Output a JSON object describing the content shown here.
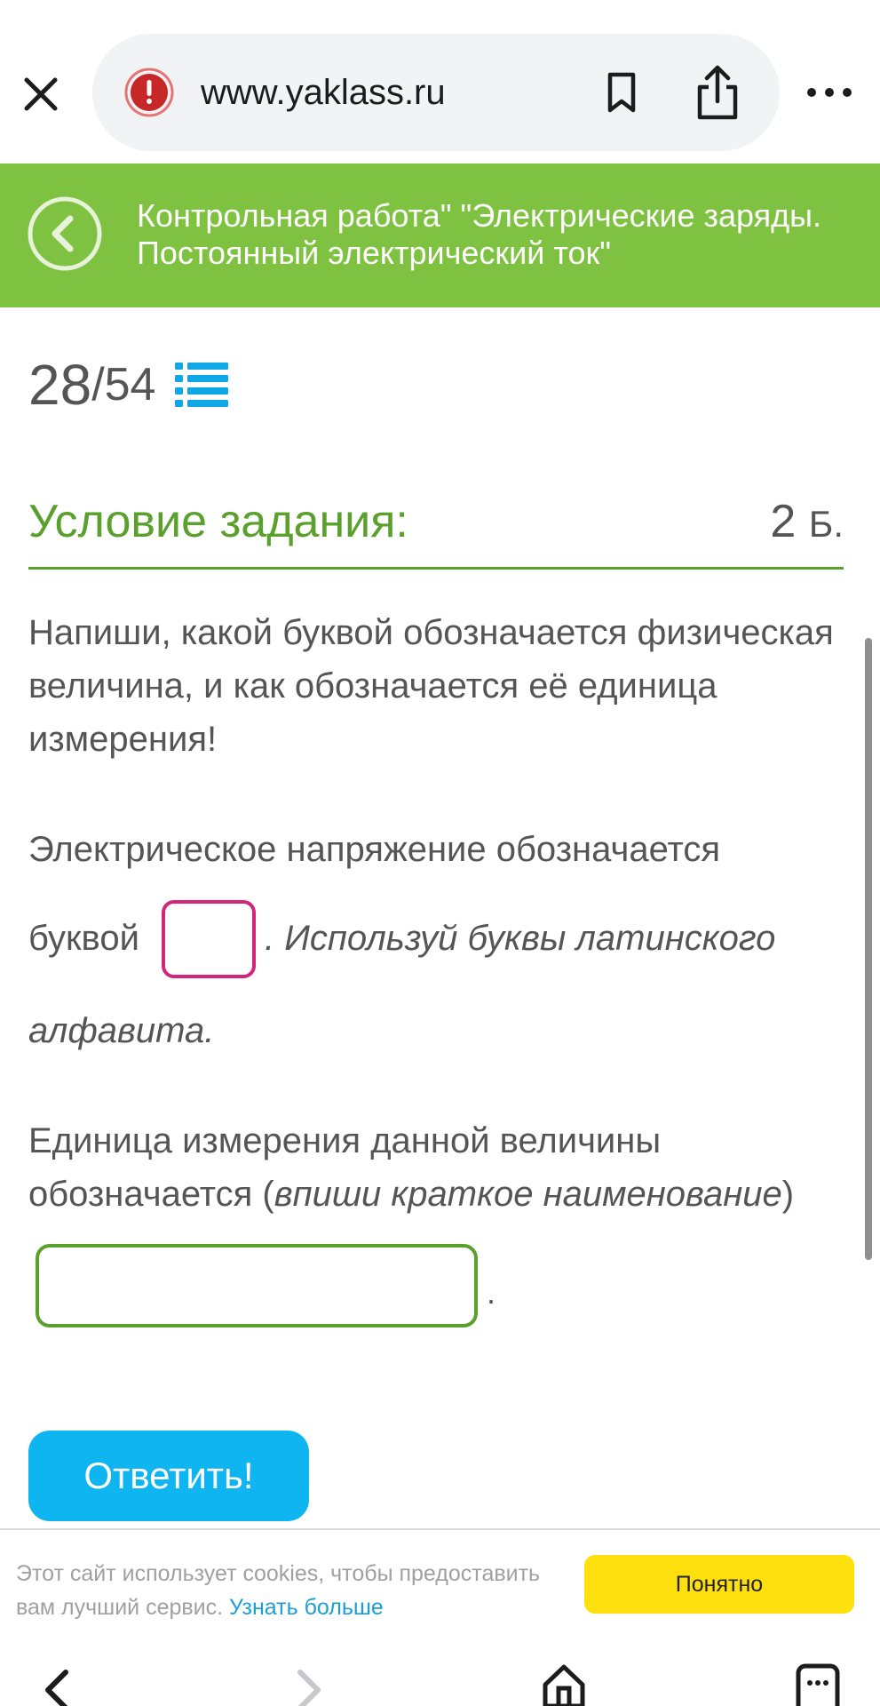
{
  "browser": {
    "url": "www.yaklass.ru"
  },
  "header": {
    "title": "Контрольная работа\" \"Электрические заряды. Постоянный электрический ток\""
  },
  "progress": {
    "current": "28",
    "separator": "/",
    "total": "54"
  },
  "section": {
    "title": "Условие задания:",
    "points_value": "2",
    "points_unit": "Б."
  },
  "task": {
    "instruction": "Напиши, какой буквой обозначается физическая величина, и как обозначается её единица измерения!",
    "line1": "Электрическое напряжение обозначается",
    "line2_prefix": "буквой",
    "line2_hint": ". Используй буквы латинского",
    "line3_hint": "алфавита.",
    "unit_line1": "Единица измерения данной величины",
    "unit_line2_prefix": "обозначается (",
    "unit_line2_hint": "впиши краткое наименование",
    "unit_line2_suffix": ")",
    "unit_after": ".",
    "letter_value": "",
    "unit_value": ""
  },
  "actions": {
    "answer_label": "Ответить!"
  },
  "cookie": {
    "text": "Этот сайт использует cookies, чтобы предоставить вам лучший сервис.",
    "link": "Узнать больше",
    "accept": "Понятно"
  },
  "colors": {
    "header_green": "#7fc241",
    "accent_green": "#5aa02c",
    "letter_input_border": "#d1267a",
    "answer_button": "#0fb5f0",
    "cookie_button": "#fde00d",
    "warning_red": "#c62828"
  },
  "icons": {
    "close": "close-icon",
    "warning": "warning-icon",
    "bookmark": "bookmark-icon",
    "share": "share-icon",
    "more": "more-icon",
    "back": "back-icon",
    "list": "list-icon"
  }
}
